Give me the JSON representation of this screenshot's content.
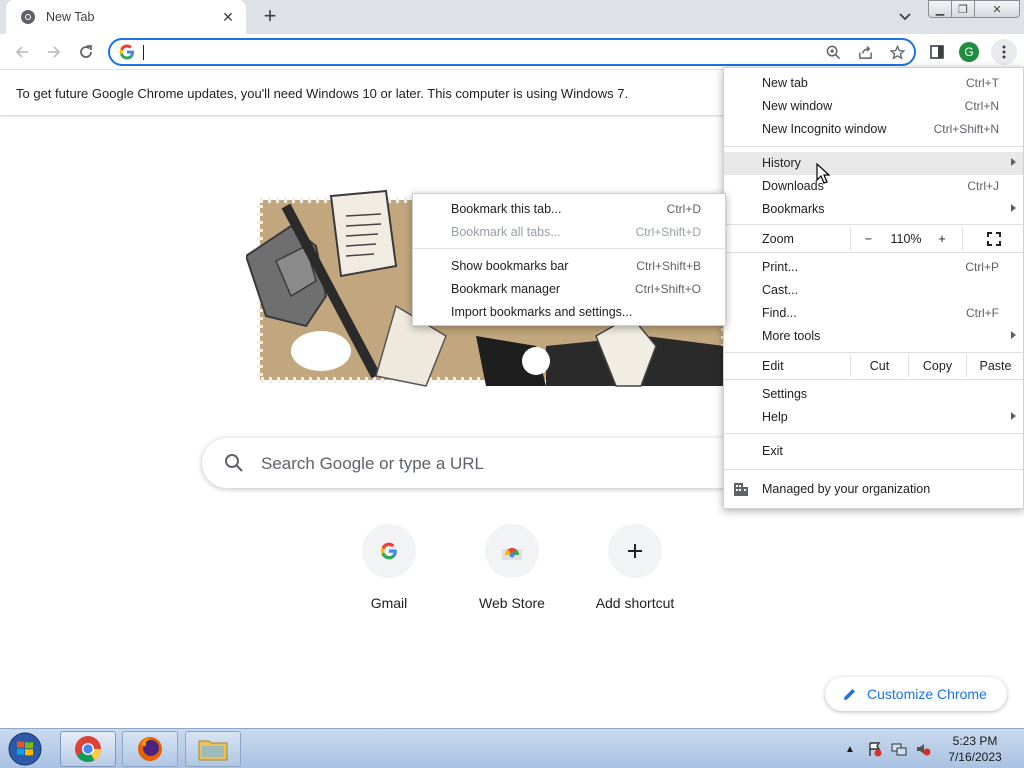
{
  "tab": {
    "title": "New Tab"
  },
  "infobar": {
    "message": "To get future Google Chrome updates, you'll need Windows 10 or later. This computer is using Windows 7."
  },
  "profile": {
    "initial": "G"
  },
  "search": {
    "placeholder": "Search Google or type a URL"
  },
  "shortcuts": [
    {
      "label": "Gmail",
      "icon": "google-g-icon"
    },
    {
      "label": "Web Store",
      "icon": "webstore-icon"
    },
    {
      "label": "Add shortcut",
      "icon": "plus-icon"
    }
  ],
  "customize": {
    "label": "Customize Chrome"
  },
  "menu": {
    "new_tab": {
      "label": "New tab",
      "shortcut": "Ctrl+T"
    },
    "new_window": {
      "label": "New window",
      "shortcut": "Ctrl+N"
    },
    "new_incognito": {
      "label": "New Incognito window",
      "shortcut": "Ctrl+Shift+N"
    },
    "history": {
      "label": "History"
    },
    "downloads": {
      "label": "Downloads",
      "shortcut": "Ctrl+J"
    },
    "bookmarks": {
      "label": "Bookmarks"
    },
    "zoom": {
      "label": "Zoom",
      "minus": "−",
      "value": "110%",
      "plus": "+"
    },
    "print": {
      "label": "Print...",
      "shortcut": "Ctrl+P"
    },
    "cast": {
      "label": "Cast..."
    },
    "find": {
      "label": "Find...",
      "shortcut": "Ctrl+F"
    },
    "more_tools": {
      "label": "More tools"
    },
    "edit": {
      "label": "Edit",
      "cut": "Cut",
      "copy": "Copy",
      "paste": "Paste"
    },
    "settings": {
      "label": "Settings"
    },
    "help": {
      "label": "Help"
    },
    "exit": {
      "label": "Exit"
    },
    "managed": {
      "label": "Managed by your organization"
    }
  },
  "bookmarks_submenu": {
    "bookmark_tab": {
      "label": "Bookmark this tab...",
      "shortcut": "Ctrl+D"
    },
    "bookmark_all": {
      "label": "Bookmark all tabs...",
      "shortcut": "Ctrl+Shift+D"
    },
    "show_bar": {
      "label": "Show bookmarks bar",
      "shortcut": "Ctrl+Shift+B"
    },
    "manager": {
      "label": "Bookmark manager",
      "shortcut": "Ctrl+Shift+O"
    },
    "import": {
      "label": "Import bookmarks and settings..."
    }
  },
  "taskbar": {
    "clock_time": "5:23 PM",
    "clock_date": "7/16/2023"
  },
  "colors": {
    "accent": "#1a73e8",
    "profile_avatar": "#1e8e3e",
    "menu_hover": "#e8e8e9"
  }
}
